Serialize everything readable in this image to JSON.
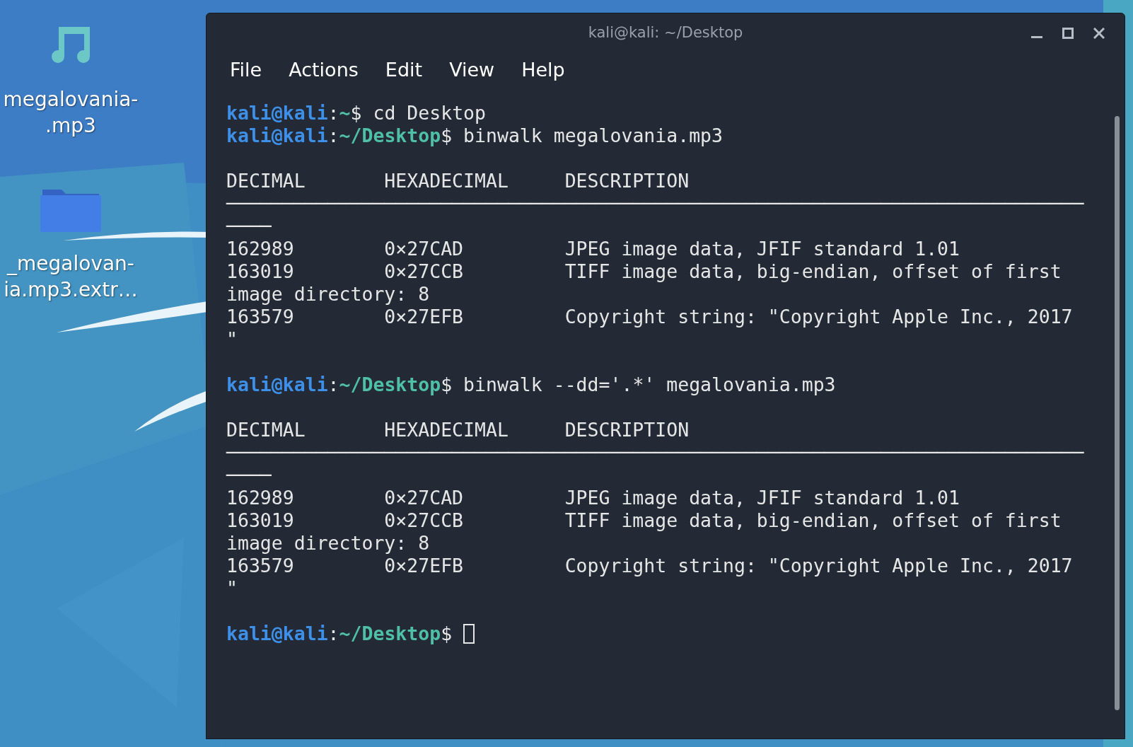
{
  "desktop": {
    "icons": [
      {
        "kind": "audio",
        "label": "megalovania-\n.mp3"
      },
      {
        "kind": "folder",
        "label": "_megalovan-\nia.mp3.extr…"
      }
    ]
  },
  "window": {
    "title": "kali@kali: ~/Desktop",
    "controls": [
      {
        "kind": "minimize"
      },
      {
        "kind": "maximize"
      },
      {
        "kind": "close"
      }
    ]
  },
  "menu": [
    "File",
    "Actions",
    "Edit",
    "View",
    "Help"
  ],
  "terminal": {
    "lines": [
      {
        "kind": "prompt",
        "user": "kali@kali",
        "sep": ":",
        "path": "~",
        "symbol": "$",
        "command": " cd Desktop",
        "cursor": false
      },
      {
        "kind": "prompt",
        "user": "kali@kali",
        "sep": ":",
        "path": "~/Desktop",
        "symbol": "$",
        "command": " binwalk megalovania.mp3",
        "cursor": false
      },
      {
        "kind": "blank"
      },
      {
        "kind": "text",
        "text": "DECIMAL       HEXADECIMAL     DESCRIPTION"
      },
      {
        "kind": "text",
        "text": "────────────────────────────────────────────────────────────────────────────"
      },
      {
        "kind": "text",
        "text": "────"
      },
      {
        "kind": "text",
        "text": "162989        0×27CAD         JPEG image data, JFIF standard 1.01"
      },
      {
        "kind": "text",
        "text": "163019        0×27CCB         TIFF image data, big-endian, offset of first"
      },
      {
        "kind": "text",
        "text": "image directory: 8"
      },
      {
        "kind": "text",
        "text": "163579        0×27EFB         Copyright string: \"Copyright Apple Inc., 2017"
      },
      {
        "kind": "text",
        "text": "\""
      },
      {
        "kind": "blank"
      },
      {
        "kind": "prompt",
        "user": "kali@kali",
        "sep": ":",
        "path": "~/Desktop",
        "symbol": "$",
        "command": " binwalk --dd='.*' megalovania.mp3",
        "cursor": false
      },
      {
        "kind": "blank"
      },
      {
        "kind": "text",
        "text": "DECIMAL       HEXADECIMAL     DESCRIPTION"
      },
      {
        "kind": "text",
        "text": "────────────────────────────────────────────────────────────────────────────"
      },
      {
        "kind": "text",
        "text": "────"
      },
      {
        "kind": "text",
        "text": "162989        0×27CAD         JPEG image data, JFIF standard 1.01"
      },
      {
        "kind": "text",
        "text": "163019        0×27CCB         TIFF image data, big-endian, offset of first"
      },
      {
        "kind": "text",
        "text": "image directory: 8"
      },
      {
        "kind": "text",
        "text": "163579        0×27EFB         Copyright string: \"Copyright Apple Inc., 2017"
      },
      {
        "kind": "text",
        "text": "\""
      },
      {
        "kind": "blank"
      },
      {
        "kind": "prompt",
        "user": "kali@kali",
        "sep": ":",
        "path": "~/Desktop",
        "symbol": "$",
        "cursor": true
      }
    ]
  }
}
